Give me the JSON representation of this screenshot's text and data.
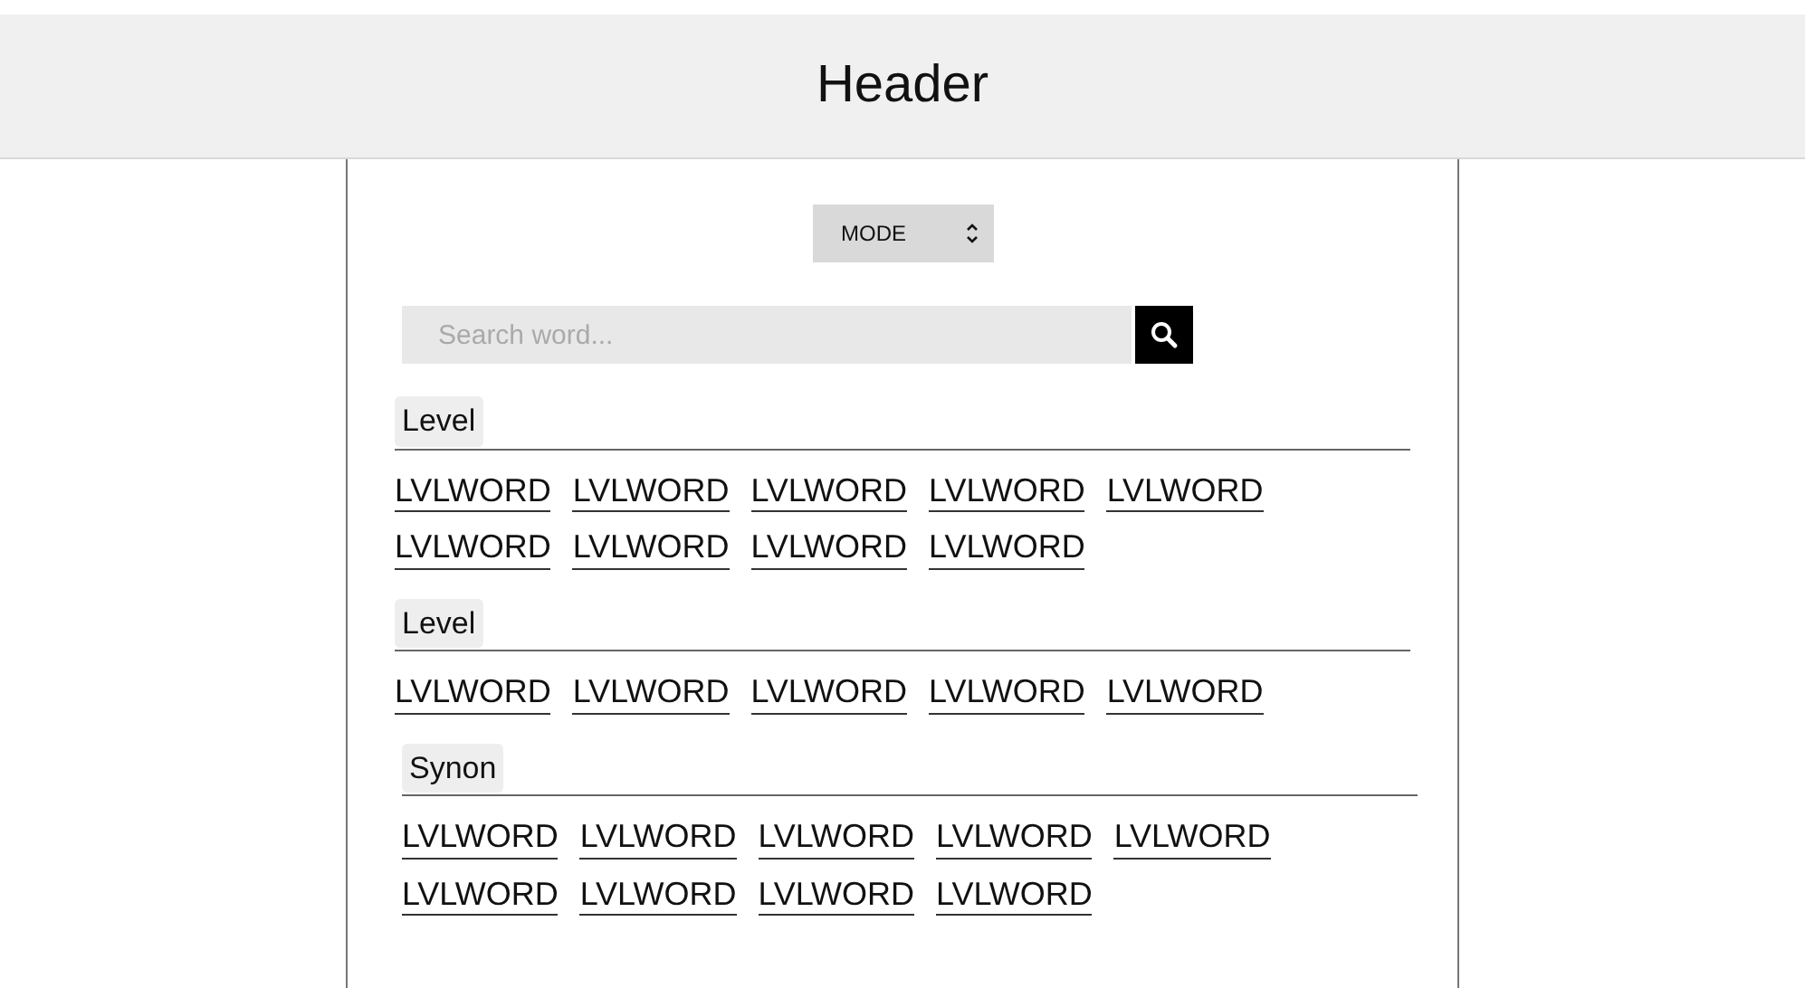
{
  "header": {
    "title": "Header"
  },
  "mode_select": {
    "value": "MODE"
  },
  "search": {
    "placeholder": "Search word..."
  },
  "sections": [
    {
      "label": "Level",
      "words": [
        "LVLWORD",
        "LVLWORD",
        "LVLWORD",
        "LVLWORD",
        "LVLWORD",
        "LVLWORD",
        "LVLWORD",
        "LVLWORD",
        "LVLWORD"
      ]
    },
    {
      "label": "Level",
      "words": [
        "LVLWORD",
        "LVLWORD",
        "LVLWORD",
        "LVLWORD",
        "LVLWORD"
      ]
    },
    {
      "label": "Synon",
      "words": [
        "LVLWORD",
        "LVLWORD",
        "LVLWORD",
        "LVLWORD",
        "LVLWORD",
        "LVLWORD",
        "LVLWORD",
        "LVLWORD",
        "LVLWORD"
      ]
    }
  ]
}
